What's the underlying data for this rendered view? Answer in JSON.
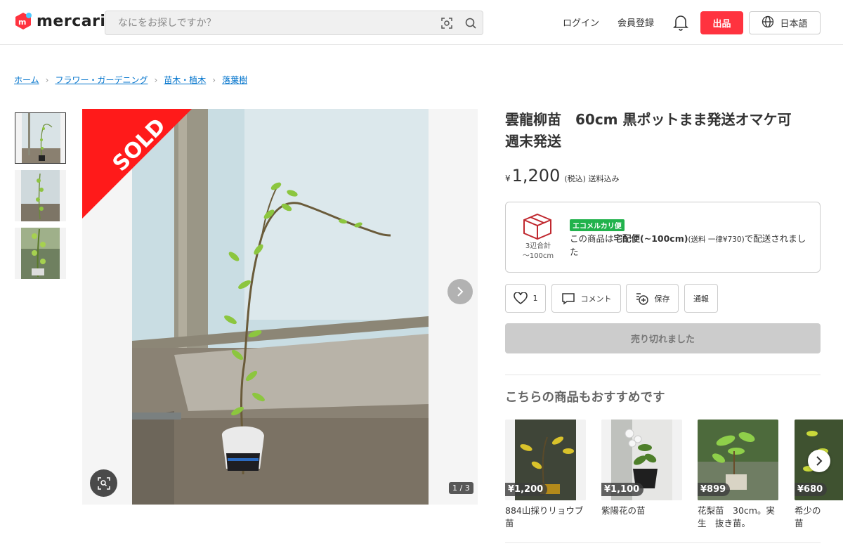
{
  "header": {
    "logo_text": "mercari",
    "search_placeholder": "なにをお探しですか？",
    "login": "ログイン",
    "signup": "会員登録",
    "sell": "出品",
    "language": "日本語"
  },
  "breadcrumb": [
    "ホーム",
    "フラワー・ガーデニング",
    "苗木・植木",
    "落葉樹"
  ],
  "gallery": {
    "sold_label": "SOLD",
    "counter": "1 / 3",
    "thumb_count": 3
  },
  "item": {
    "title": "雲龍柳苗　60cm 黒ポットまま発送オマケ可　週末発送",
    "currency": "¥",
    "price": "1,200",
    "price_note": "(税込) 送料込み"
  },
  "shipping": {
    "box_caption": "3辺合計\n〜100cm",
    "eco_badge": "エコメルカリ便",
    "text_before": "この商品は",
    "method": "宅配便(~100cm)",
    "fee": "(送料 一律¥730)",
    "text_after": "で配送されました"
  },
  "actions": {
    "like_count": "1",
    "comment": "コメント",
    "save": "保存",
    "report": "通報",
    "sold_out": "売り切れました"
  },
  "recommend": {
    "title": "こちらの商品もおすすめです",
    "items": [
      {
        "price": "¥1,200",
        "name": "884山採りリョウブ苗"
      },
      {
        "price": "¥1,100",
        "name": "紫陽花の苗"
      },
      {
        "price": "¥899",
        "name": "花梨苗　30cm。実生　抜き苗。"
      },
      {
        "price": "¥680",
        "name": "希少の苗"
      }
    ]
  },
  "colors": {
    "brand_red": "#ff333f",
    "link_blue": "#0073cc",
    "eco_green": "#21b24c",
    "sold_red": "#ff1a1a"
  }
}
